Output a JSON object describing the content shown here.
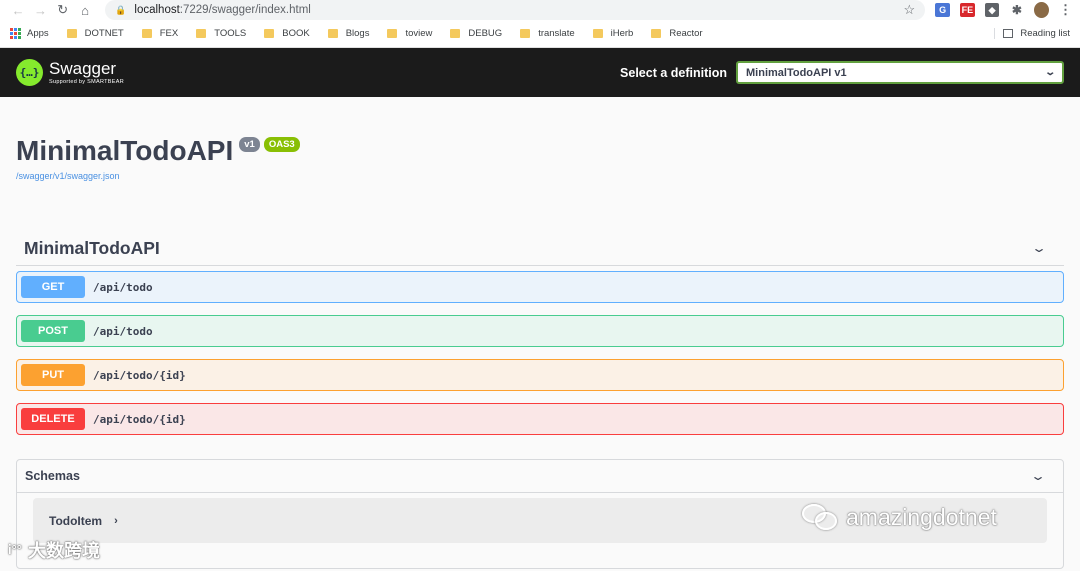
{
  "browser": {
    "url_host": "localhost",
    "url_path": ":7229/swagger/index.html",
    "bookmarks": [
      "Apps",
      "DOTNET",
      "FEX",
      "TOOLS",
      "BOOK",
      "Blogs",
      "toview",
      "DEBUG",
      "translate",
      "iHerb",
      "Reactor"
    ],
    "reading_list": "Reading list"
  },
  "topbar": {
    "logo_name": "Swagger",
    "logo_sub": "Supported by SMARTBEAR",
    "logo_glyph": "{…}",
    "definition_label": "Select a definition",
    "definition_value": "MinimalTodoAPI v1"
  },
  "info": {
    "title": "MinimalTodoAPI",
    "version_badge": "v1",
    "oas_badge": "OAS3",
    "spec_url": "/swagger/v1/swagger.json"
  },
  "tag": {
    "name": "MinimalTodoAPI",
    "operations": [
      {
        "method": "GET",
        "path": "/api/todo",
        "color": "#61affe"
      },
      {
        "method": "POST",
        "path": "/api/todo",
        "color": "#49cc90"
      },
      {
        "method": "PUT",
        "path": "/api/todo/{id}",
        "color": "#fca130"
      },
      {
        "method": "DELETE",
        "path": "/api/todo/{id}",
        "color": "#f93e3e"
      }
    ]
  },
  "schemas": {
    "title": "Schemas",
    "models": [
      "TodoItem"
    ]
  },
  "watermarks": {
    "left": "大数跨境",
    "right": "amazingdotnet"
  }
}
